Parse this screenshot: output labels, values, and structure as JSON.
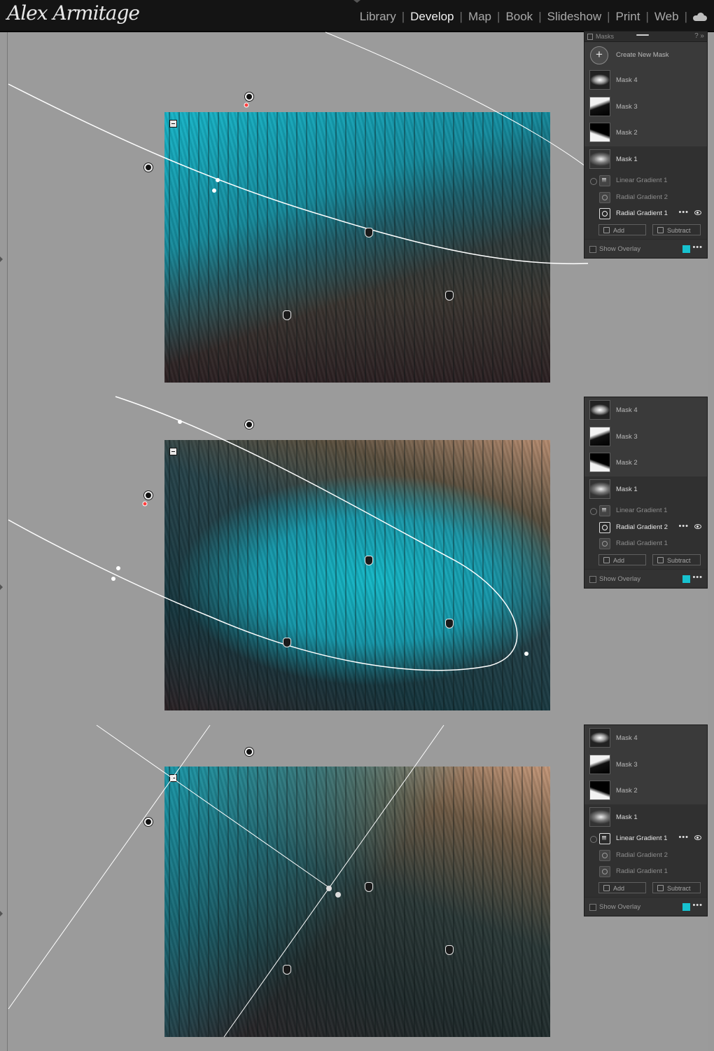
{
  "app": {
    "brand": "Alex Armitage",
    "modules": [
      "Library",
      "Develop",
      "Map",
      "Book",
      "Slideshow",
      "Print",
      "Web"
    ],
    "active_module": "Develop"
  },
  "panels": [
    {
      "title": "Masks",
      "create_label": "Create New Mask",
      "masks": [
        "Mask 4",
        "Mask 3",
        "Mask 2",
        "Mask 1"
      ],
      "components": [
        "Linear Gradient 1",
        "Radial Gradient 2",
        "Radial Gradient 1"
      ],
      "active_component": "Radial Gradient 1",
      "add_label": "Add",
      "subtract_label": "Subtract",
      "show_overlay_label": "Show Overlay",
      "overlay_color": "#17c2cf"
    },
    {
      "masks": [
        "Mask 4",
        "Mask 3",
        "Mask 2",
        "Mask 1"
      ],
      "components": [
        "Linear Gradient 1",
        "Radial Gradient 2",
        "Radial Gradient 1"
      ],
      "active_component": "Radial Gradient 2",
      "add_label": "Add",
      "subtract_label": "Subtract",
      "show_overlay_label": "Show Overlay",
      "overlay_color": "#17c2cf"
    },
    {
      "masks": [
        "Mask 4",
        "Mask 3",
        "Mask 2",
        "Mask 1"
      ],
      "components": [
        "Linear Gradient 1",
        "Radial Gradient 2",
        "Radial Gradient 1"
      ],
      "active_component": "Linear Gradient 1",
      "add_label": "Add",
      "subtract_label": "Subtract",
      "show_overlay_label": "Show Overlay",
      "overlay_color": "#17c2cf"
    }
  ],
  "colors": {
    "overlay": "#17c2cf",
    "background": "#9b9b9b",
    "panel": "#3a3a3a"
  },
  "icons": [
    "plus-icon",
    "eye-icon",
    "more-icon",
    "cloud-icon",
    "help-icon",
    "collapse-icon"
  ]
}
